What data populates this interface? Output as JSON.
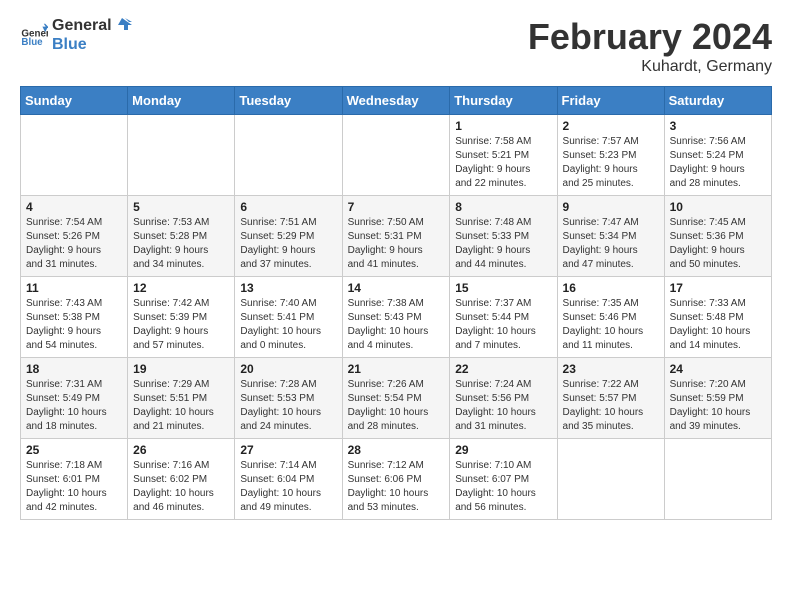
{
  "header": {
    "logo_general": "General",
    "logo_blue": "Blue",
    "month_year": "February 2024",
    "location": "Kuhardt, Germany"
  },
  "days_of_week": [
    "Sunday",
    "Monday",
    "Tuesday",
    "Wednesday",
    "Thursday",
    "Friday",
    "Saturday"
  ],
  "weeks": [
    {
      "shaded": false,
      "cells": [
        {
          "day": "",
          "content": ""
        },
        {
          "day": "",
          "content": ""
        },
        {
          "day": "",
          "content": ""
        },
        {
          "day": "",
          "content": ""
        },
        {
          "day": "1",
          "content": "Sunrise: 7:58 AM\nSunset: 5:21 PM\nDaylight: 9 hours\nand 22 minutes."
        },
        {
          "day": "2",
          "content": "Sunrise: 7:57 AM\nSunset: 5:23 PM\nDaylight: 9 hours\nand 25 minutes."
        },
        {
          "day": "3",
          "content": "Sunrise: 7:56 AM\nSunset: 5:24 PM\nDaylight: 9 hours\nand 28 minutes."
        }
      ]
    },
    {
      "shaded": true,
      "cells": [
        {
          "day": "4",
          "content": "Sunrise: 7:54 AM\nSunset: 5:26 PM\nDaylight: 9 hours\nand 31 minutes."
        },
        {
          "day": "5",
          "content": "Sunrise: 7:53 AM\nSunset: 5:28 PM\nDaylight: 9 hours\nand 34 minutes."
        },
        {
          "day": "6",
          "content": "Sunrise: 7:51 AM\nSunset: 5:29 PM\nDaylight: 9 hours\nand 37 minutes."
        },
        {
          "day": "7",
          "content": "Sunrise: 7:50 AM\nSunset: 5:31 PM\nDaylight: 9 hours\nand 41 minutes."
        },
        {
          "day": "8",
          "content": "Sunrise: 7:48 AM\nSunset: 5:33 PM\nDaylight: 9 hours\nand 44 minutes."
        },
        {
          "day": "9",
          "content": "Sunrise: 7:47 AM\nSunset: 5:34 PM\nDaylight: 9 hours\nand 47 minutes."
        },
        {
          "day": "10",
          "content": "Sunrise: 7:45 AM\nSunset: 5:36 PM\nDaylight: 9 hours\nand 50 minutes."
        }
      ]
    },
    {
      "shaded": false,
      "cells": [
        {
          "day": "11",
          "content": "Sunrise: 7:43 AM\nSunset: 5:38 PM\nDaylight: 9 hours\nand 54 minutes."
        },
        {
          "day": "12",
          "content": "Sunrise: 7:42 AM\nSunset: 5:39 PM\nDaylight: 9 hours\nand 57 minutes."
        },
        {
          "day": "13",
          "content": "Sunrise: 7:40 AM\nSunset: 5:41 PM\nDaylight: 10 hours\nand 0 minutes."
        },
        {
          "day": "14",
          "content": "Sunrise: 7:38 AM\nSunset: 5:43 PM\nDaylight: 10 hours\nand 4 minutes."
        },
        {
          "day": "15",
          "content": "Sunrise: 7:37 AM\nSunset: 5:44 PM\nDaylight: 10 hours\nand 7 minutes."
        },
        {
          "day": "16",
          "content": "Sunrise: 7:35 AM\nSunset: 5:46 PM\nDaylight: 10 hours\nand 11 minutes."
        },
        {
          "day": "17",
          "content": "Sunrise: 7:33 AM\nSunset: 5:48 PM\nDaylight: 10 hours\nand 14 minutes."
        }
      ]
    },
    {
      "shaded": true,
      "cells": [
        {
          "day": "18",
          "content": "Sunrise: 7:31 AM\nSunset: 5:49 PM\nDaylight: 10 hours\nand 18 minutes."
        },
        {
          "day": "19",
          "content": "Sunrise: 7:29 AM\nSunset: 5:51 PM\nDaylight: 10 hours\nand 21 minutes."
        },
        {
          "day": "20",
          "content": "Sunrise: 7:28 AM\nSunset: 5:53 PM\nDaylight: 10 hours\nand 24 minutes."
        },
        {
          "day": "21",
          "content": "Sunrise: 7:26 AM\nSunset: 5:54 PM\nDaylight: 10 hours\nand 28 minutes."
        },
        {
          "day": "22",
          "content": "Sunrise: 7:24 AM\nSunset: 5:56 PM\nDaylight: 10 hours\nand 31 minutes."
        },
        {
          "day": "23",
          "content": "Sunrise: 7:22 AM\nSunset: 5:57 PM\nDaylight: 10 hours\nand 35 minutes."
        },
        {
          "day": "24",
          "content": "Sunrise: 7:20 AM\nSunset: 5:59 PM\nDaylight: 10 hours\nand 39 minutes."
        }
      ]
    },
    {
      "shaded": false,
      "cells": [
        {
          "day": "25",
          "content": "Sunrise: 7:18 AM\nSunset: 6:01 PM\nDaylight: 10 hours\nand 42 minutes."
        },
        {
          "day": "26",
          "content": "Sunrise: 7:16 AM\nSunset: 6:02 PM\nDaylight: 10 hours\nand 46 minutes."
        },
        {
          "day": "27",
          "content": "Sunrise: 7:14 AM\nSunset: 6:04 PM\nDaylight: 10 hours\nand 49 minutes."
        },
        {
          "day": "28",
          "content": "Sunrise: 7:12 AM\nSunset: 6:06 PM\nDaylight: 10 hours\nand 53 minutes."
        },
        {
          "day": "29",
          "content": "Sunrise: 7:10 AM\nSunset: 6:07 PM\nDaylight: 10 hours\nand 56 minutes."
        },
        {
          "day": "",
          "content": ""
        },
        {
          "day": "",
          "content": ""
        }
      ]
    }
  ]
}
